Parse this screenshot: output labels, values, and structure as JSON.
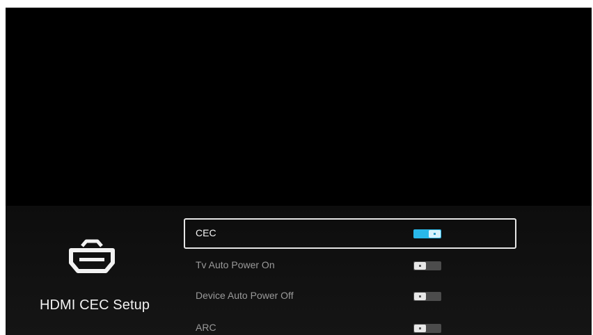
{
  "panel": {
    "title": "HDMI CEC Setup",
    "icon": "hdmi-port-icon"
  },
  "settings": [
    {
      "label": "CEC",
      "state": "on",
      "focused": true
    },
    {
      "label": "Tv Auto Power On",
      "state": "off",
      "focused": false
    },
    {
      "label": "Device Auto Power Off",
      "state": "off",
      "focused": false
    },
    {
      "label": "ARC",
      "state": "off",
      "focused": false
    }
  ],
  "colors": {
    "background": "#000000",
    "toggle_on": "#29b8ea",
    "toggle_off": "#4c4c4c",
    "focus_border": "#e6e6e6"
  }
}
